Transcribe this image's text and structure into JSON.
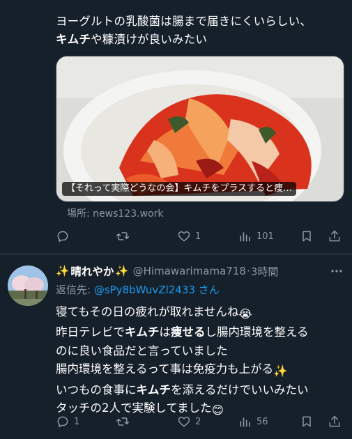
{
  "post1": {
    "text_line1": "ヨーグルトの乳酸菌は腸まで届きにくいらしい、",
    "text_line2_bold": "キムチ",
    "text_line2_rest": "や糠漬けが良いみたい",
    "card": {
      "caption": "【それって実際どうなの会】キムチをプラスすると痩…",
      "domain": "場所: news123.work"
    },
    "actions": {
      "replies": "",
      "reposts": "",
      "likes": "1",
      "views": "101"
    }
  },
  "post2": {
    "name_emoji_left": "✨",
    "name": "晴れやか",
    "name_emoji_right": "✨",
    "handle": "@Himawarimama718",
    "separator": "·",
    "time": "3時間",
    "reply_prefix": "返信先: ",
    "reply_mention": "@sPy8bWuvZl2433",
    "reply_suffix": " さん",
    "lines": {
      "l1": "寝てもその日の疲れが取れませんね",
      "l1_emoji": "😭",
      "l2_a": "昨日テレビで",
      "l2_b": "キムチ",
      "l2_c": "は",
      "l2_d": "痩せる",
      "l2_e": "し腸内環境を整える",
      "l3": "のに良い食品だと言っていました",
      "l4": "腸内環境を整えるって事は免疫力も上がる",
      "l4_emoji": "✨",
      "l5_a": "いつもの食事に",
      "l5_b": "キムチ",
      "l5_c": "を添えるだけでいいみたい",
      "l6": "タッチの2人で実験してました",
      "l6_emoji": "😊"
    },
    "actions": {
      "replies": "1",
      "reposts": "",
      "likes": "2",
      "views": "56"
    }
  },
  "colors": {
    "background": "#15202b",
    "muted": "#8b98a5",
    "accent": "#1d9bf0",
    "border": "#38444d"
  }
}
